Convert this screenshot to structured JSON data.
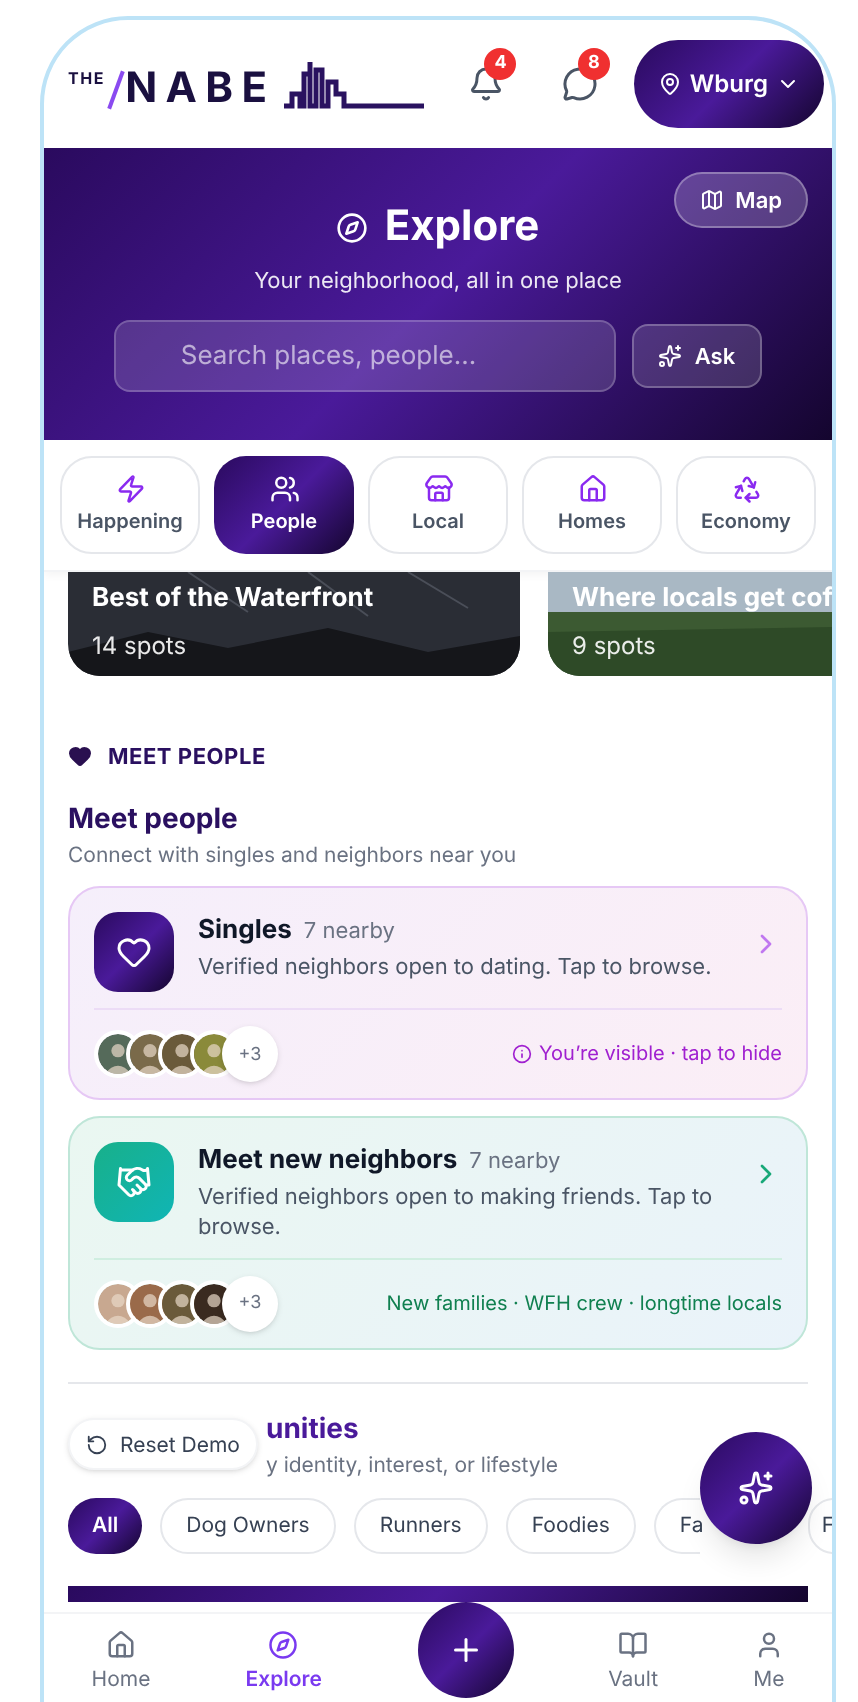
{
  "header": {
    "logo_small": "THE",
    "logo_main": "NABE",
    "notifications_badge": "4",
    "messages_badge": "8",
    "location": "Wburg"
  },
  "hero": {
    "map_button": "Map",
    "title": "Explore",
    "subtitle": "Your neighborhood, all in one place",
    "search": {
      "placeholder": "Search places, people..."
    },
    "ask_button": "Ask"
  },
  "tabs": [
    {
      "label": "Happening",
      "selected": false
    },
    {
      "label": "People",
      "selected": true
    },
    {
      "label": "Local",
      "selected": false
    },
    {
      "label": "Homes",
      "selected": false
    },
    {
      "label": "Economy",
      "selected": false
    }
  ],
  "guides": [
    {
      "title": "Best of the Waterfront",
      "count": "14 spots",
      "kind": "night"
    },
    {
      "title": "Where locals get cof",
      "count": "9 spots",
      "kind": "field"
    }
  ],
  "meet_section": {
    "label": "MEET PEOPLE",
    "title": "Meet people",
    "subtitle": "Connect with singles and neighbors near you"
  },
  "meet_cards": [
    {
      "kind": "singles",
      "title": "Singles",
      "nearby": "7 nearby",
      "description": "Verified neighbors open to dating. Tap to browse.",
      "more": "+3",
      "footer": "You’re visible · tap to hide"
    },
    {
      "kind": "neighbors",
      "title": "Meet new neighbors",
      "nearby": "7 nearby",
      "description": "Verified neighbors open to making friends. Tap to browse.",
      "more": "+3",
      "footer": "New families · WFH crew · longtime locals"
    }
  ],
  "groups": {
    "title": "unities",
    "subtitle": "y identity, interest, or lifestyle",
    "chips": [
      {
        "label": "All",
        "selected": true
      },
      {
        "label": "Dog Owners",
        "selected": false
      },
      {
        "label": "Runners",
        "selected": false
      },
      {
        "label": "Foodies",
        "selected": false
      },
      {
        "label": "Fa",
        "selected": false
      },
      {
        "label": "F",
        "selected": false
      }
    ]
  },
  "reset_button": "Reset Demo",
  "nav": [
    {
      "kind": "tab",
      "label": "Home",
      "selected": false
    },
    {
      "kind": "tab",
      "label": "Explore",
      "selected": true
    },
    {
      "kind": "add"
    },
    {
      "kind": "tab",
      "label": "Vault",
      "selected": false
    },
    {
      "kind": "tab",
      "label": "Me",
      "selected": false
    }
  ]
}
